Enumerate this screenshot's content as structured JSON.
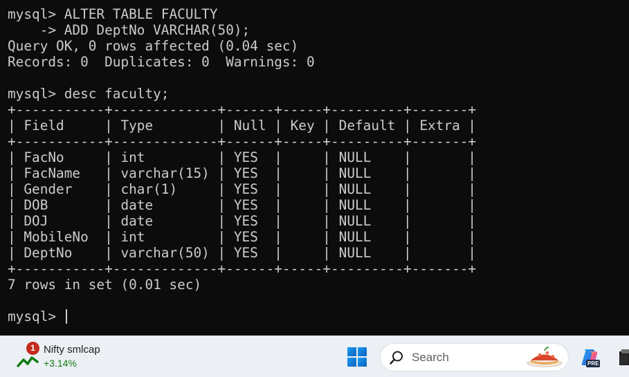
{
  "terminal": {
    "lines": [
      "mysql> ALTER TABLE FACULTY",
      "    -> ADD DeptNo VARCHAR(50);",
      "Query OK, 0 rows affected (0.04 sec)",
      "Records: 0  Duplicates: 0  Warnings: 0",
      "",
      "mysql> desc faculty;",
      "+-----------+-------------+------+-----+---------+-------+",
      "| Field     | Type        | Null | Key | Default | Extra |",
      "+-----------+-------------+------+-----+---------+-------+",
      "| FacNo     | int         | YES  |     | NULL    |       |",
      "| FacName   | varchar(15) | YES  |     | NULL    |       |",
      "| Gender    | char(1)     | YES  |     | NULL    |       |",
      "| DOB       | date        | YES  |     | NULL    |       |",
      "| DOJ       | date        | YES  |     | NULL    |       |",
      "| MobileNo  | int         | YES  |     | NULL    |       |",
      "| DeptNo    | varchar(50) | YES  |     | NULL    |       |",
      "+-----------+-------------+------+-----+---------+-------+",
      "7 rows in set (0.01 sec)",
      "",
      "mysql> "
    ]
  },
  "taskbar": {
    "widget": {
      "badge": "1",
      "name": "Nifty smlcap",
      "change": "+3.14%",
      "icon": "stock-trend-icon"
    },
    "search": {
      "label": "Search",
      "icon": "search-icon"
    },
    "copilot": {
      "tag": "PRE",
      "icon": "copilot-icon"
    },
    "colors": {
      "terminal_bg": "#0c0c0c",
      "terminal_fg": "#cccccc",
      "taskbar_bg": "#ecf0f5",
      "badge": "#c42b1c",
      "positive_change": "#0f7b0f",
      "start_blue": "#0a74d6"
    }
  }
}
